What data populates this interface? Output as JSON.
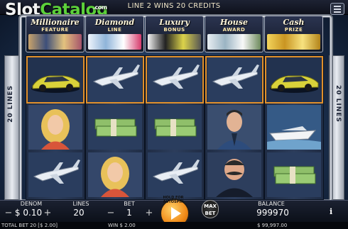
{
  "watermark": {
    "part1": "Slot",
    "part2": "Catalog",
    "tld": ".com"
  },
  "top_message": "LINE 2 WINS 20 CREDITS",
  "jackpots": [
    {
      "title": "Millionaire",
      "sub": "FEATURE",
      "color": "#e6b34a"
    },
    {
      "title": "Diamond",
      "sub": "LINE",
      "color": "#d8e6f5"
    },
    {
      "title": "Luxury",
      "sub": "BONUS",
      "color": "#f0d24a"
    },
    {
      "title": "House",
      "sub": "AWARD",
      "color": "#cfe0e8"
    },
    {
      "title": "Cash",
      "sub": "PRIZE",
      "color": "#f0c43a"
    }
  ],
  "side_label": "20 LINES",
  "reels": [
    [
      "sports-car",
      "blonde-woman",
      "private-jet"
    ],
    [
      "private-jet",
      "cash-stack",
      "blonde-woman"
    ],
    [
      "private-jet",
      "cash-stack",
      "private-jet"
    ],
    [
      "private-jet",
      "businessman",
      "mustache-tycoon"
    ],
    [
      "sports-car",
      "yacht",
      "cash-stack"
    ]
  ],
  "winning_row": 0,
  "controls": {
    "denom_label": "DENOM",
    "denom_value": "0.10",
    "lines_label": "LINES",
    "lines_value": "20",
    "bet_label": "BET",
    "bet_value": "1",
    "max_bet_label": "MAX BET",
    "spin_hint": "HOLD FOR AUTOSPIN",
    "balance_label": "BALANCE",
    "balance_value": "999970",
    "minus": "−",
    "plus": "+",
    "dollar": "$",
    "info": "i"
  },
  "status": {
    "total_bet": "TOTAL BET 20 [$ 2.00]",
    "win": "WIN  $ 2.00",
    "balance": "$ 99,997.00"
  },
  "colors": {
    "win_highlight": "#e0902c",
    "spin": "#f08a17",
    "catalog_green": "#5cd13a"
  }
}
